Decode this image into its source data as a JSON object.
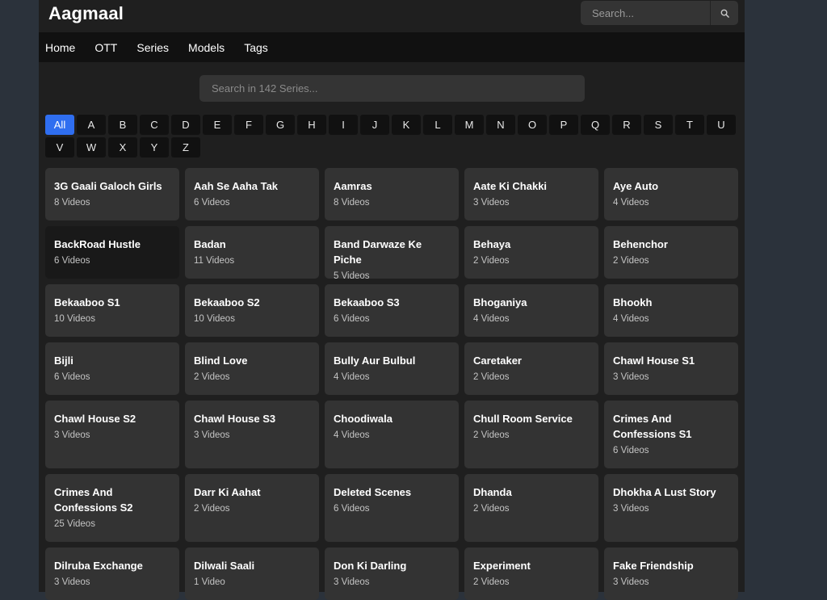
{
  "brand": "Aagmaal",
  "header_search": {
    "placeholder": "Search..."
  },
  "nav": [
    "Home",
    "OTT",
    "Series",
    "Models",
    "Tags"
  ],
  "series_search": {
    "placeholder": "Search in 142 Series..."
  },
  "letters": [
    "All",
    "A",
    "B",
    "C",
    "D",
    "E",
    "F",
    "G",
    "H",
    "I",
    "J",
    "K",
    "L",
    "M",
    "N",
    "O",
    "P",
    "Q",
    "R",
    "S",
    "T",
    "U",
    "V",
    "W",
    "X",
    "Y",
    "Z"
  ],
  "active_letter": "All",
  "series": [
    {
      "title": "3G Gaali Galoch Girls",
      "count": "8 Videos"
    },
    {
      "title": "Aah Se Aaha Tak",
      "count": "6 Videos"
    },
    {
      "title": "Aamras",
      "count": "8 Videos"
    },
    {
      "title": "Aate Ki Chakki",
      "count": "3 Videos"
    },
    {
      "title": "Aye Auto",
      "count": "4 Videos"
    },
    {
      "title": "BackRoad Hustle",
      "count": "6 Videos"
    },
    {
      "title": "Badan",
      "count": "11 Videos"
    },
    {
      "title": "Band Darwaze Ke Piche",
      "count": "5 Videos"
    },
    {
      "title": "Behaya",
      "count": "2 Videos"
    },
    {
      "title": "Behenchor",
      "count": "2 Videos"
    },
    {
      "title": "Bekaaboo S1",
      "count": "10 Videos"
    },
    {
      "title": "Bekaaboo S2",
      "count": "10 Videos"
    },
    {
      "title": "Bekaaboo S3",
      "count": "6 Videos"
    },
    {
      "title": "Bhoganiya",
      "count": "4 Videos"
    },
    {
      "title": "Bhookh",
      "count": "4 Videos"
    },
    {
      "title": "Bijli",
      "count": "6 Videos"
    },
    {
      "title": "Blind Love",
      "count": "2 Videos"
    },
    {
      "title": "Bully Aur Bulbul",
      "count": "4 Videos"
    },
    {
      "title": "Caretaker",
      "count": "2 Videos"
    },
    {
      "title": "Chawl House S1",
      "count": "3 Videos"
    },
    {
      "title": "Chawl House S2",
      "count": "3 Videos"
    },
    {
      "title": "Chawl House S3",
      "count": "3 Videos"
    },
    {
      "title": "Choodiwala",
      "count": "4 Videos"
    },
    {
      "title": "Chull Room Service",
      "count": "2 Videos"
    },
    {
      "title": "Crimes And Confessions S1",
      "count": "6 Videos"
    },
    {
      "title": "Crimes And Confessions S2",
      "count": "25 Videos"
    },
    {
      "title": "Darr Ki Aahat",
      "count": "2 Videos"
    },
    {
      "title": "Deleted Scenes",
      "count": "6 Videos"
    },
    {
      "title": "Dhanda",
      "count": "2 Videos"
    },
    {
      "title": "Dhokha A Lust Story",
      "count": "3 Videos"
    },
    {
      "title": "Dilruba Exchange",
      "count": "3 Videos"
    },
    {
      "title": "Dilwali Saali",
      "count": "1 Video"
    },
    {
      "title": "Don Ki Darling",
      "count": "3 Videos"
    },
    {
      "title": "Experiment",
      "count": "2 Videos"
    },
    {
      "title": "Fake Friendship",
      "count": "3 Videos"
    }
  ],
  "hovered_card_index": 5,
  "icons": {
    "search": "search-icon"
  },
  "colors": {
    "accent": "#2f6ef0",
    "card": "#333333",
    "nav_bg": "#111111",
    "page_bg": "#1f1f1f",
    "outer_bg": "#2b323b"
  }
}
